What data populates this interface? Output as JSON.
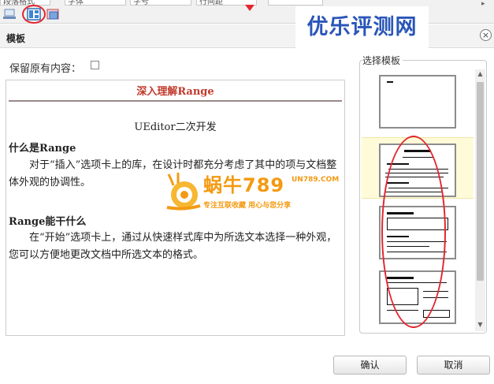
{
  "toolbar": {
    "selects": [
      "段落格式",
      "字体",
      "字号",
      "行间距"
    ]
  },
  "watermark": {
    "banner_text": "优乐评测网",
    "snail_name": "蜗牛789",
    "snail_domain": "UN789.COM",
    "snail_slogan": "专注互联收藏  用心与您分享"
  },
  "dialog": {
    "title": "模板",
    "close_symbol": "×",
    "keep_label": "保留原有内容：",
    "keep_checked": false
  },
  "preview": {
    "title": "深入理解Range",
    "subtitle": "UEditor二次开发",
    "heading1": "什么是Range",
    "para1": "对于“插入”选项卡上的库，在设计时都充分考虑了其中的项与文档整体外观的协调性。",
    "heading2": "Range能干什么",
    "para2": "在“开始”选项卡上，通过从快速样式库中为所选文本选择一种外观，您可以方便地更改文档中所选文本的格式。"
  },
  "templates": {
    "label": "选择模板",
    "selected_index": 1,
    "count": 4
  },
  "footer": {
    "ok_label": "确认",
    "cancel_label": "取消"
  },
  "colors": {
    "annotation_red": "#e3262f",
    "preview_title": "#c0392b",
    "banner_blue": "#2a56b8",
    "snail_orange": "#f39a12",
    "selected_row": "#fffbd9"
  }
}
